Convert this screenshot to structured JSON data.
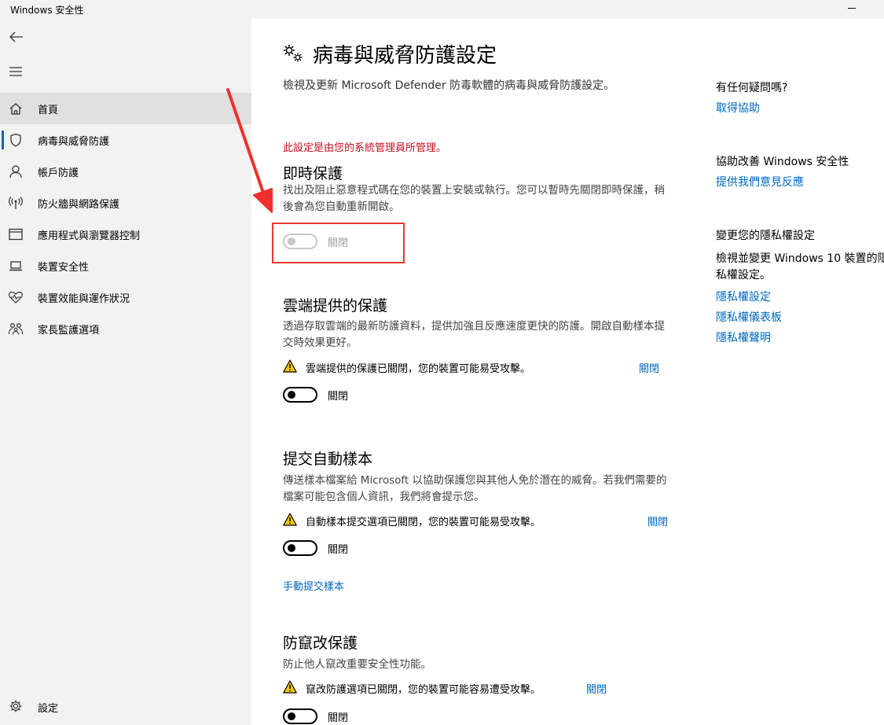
{
  "window": {
    "title": "Windows 安全性"
  },
  "sidebar": {
    "items": [
      {
        "label": "首頁",
        "icon": "home-icon"
      },
      {
        "label": "病毒與威脅防護",
        "icon": "shield-icon"
      },
      {
        "label": "帳戶防護",
        "icon": "person-icon"
      },
      {
        "label": "防火牆與網路保護",
        "icon": "antenna-icon"
      },
      {
        "label": "應用程式與瀏覽器控制",
        "icon": "app-window-icon"
      },
      {
        "label": "裝置安全性",
        "icon": "laptop-icon"
      },
      {
        "label": "裝置效能與運作狀況",
        "icon": "heart-pulse-icon"
      },
      {
        "label": "家長監護選項",
        "icon": "family-icon"
      }
    ],
    "settings_label": "設定"
  },
  "main": {
    "title": "病毒與威脅防護設定",
    "description": "檢視及更新 Microsoft Defender 防毒軟體的病毒與威脅防護設定。",
    "admin_note": "此設定是由您的系統管理員所管理。",
    "realtime": {
      "title": "即時保護",
      "desc": "找出及阻止惡意程式碼在您的裝置上安裝或執行。您可以暫時先關閉即時保護，稍後會為您自動重新開啟。",
      "toggle_label": "關閉"
    },
    "cloud": {
      "title": "雲端提供的保護",
      "desc": "透過存取雲端的最新防護資料，提供加強且反應速度更快的防護。開啟自動樣本提交時效果更好。",
      "warning": "雲端提供的保護已關閉，您的裝置可能易受攻擊。",
      "dismiss": "關閉",
      "toggle_label": "關閉"
    },
    "sample": {
      "title": "提交自動樣本",
      "desc": "傳送樣本檔案給 Microsoft 以協助保護您與其他人免於潛在的威脅。若我們需要的檔案可能包含個人資訊，我們將會提示您。",
      "warning": "自動樣本提交選項已關閉，您的裝置可能易受攻擊。",
      "dismiss": "關閉",
      "toggle_label": "關閉",
      "manual_link": "手動提交樣本"
    },
    "tamper": {
      "title": "防竄改保護",
      "desc": "防止他人竄改重要安全性功能。",
      "warning": "竄改防護選項已關閉，您的裝置可能容易遭受攻擊。",
      "dismiss": "關閉",
      "toggle_label": "關閉"
    }
  },
  "right": {
    "help_head": "有任何疑問嗎?",
    "help_link": "取得協助",
    "improve_head": "協助改善 Windows 安全性",
    "improve_link": "提供我們意見反應",
    "privacy_head": "變更您的隱私權設定",
    "privacy_text": "檢視並變更 Windows 10 裝置的隱私權設定。",
    "privacy_links": [
      "隱私權設定",
      "隱私權儀表板",
      "隱私權聲明"
    ]
  },
  "colors": {
    "accent": "#0067c0",
    "admin_note": "#c50f1f",
    "highlight": "#e53935",
    "warning": "#f2c600"
  }
}
